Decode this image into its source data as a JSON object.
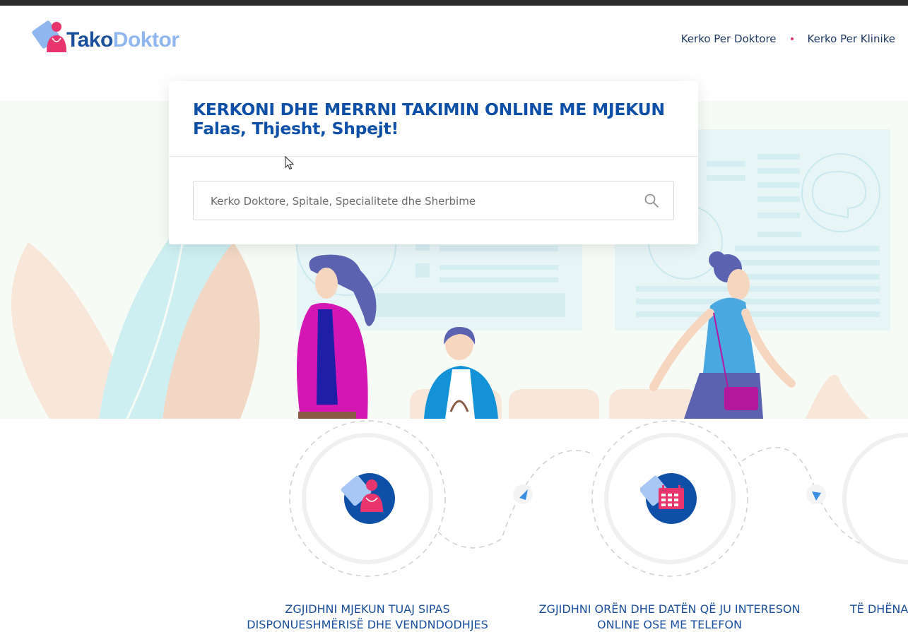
{
  "header": {
    "logo": {
      "part1": "Tako",
      "part2": "Doktor"
    },
    "nav": [
      {
        "label": "Kerko Per Doktore"
      },
      {
        "label": "Kerko Per Klinike"
      }
    ]
  },
  "search_card": {
    "title_line1": "KERKONI DHE MERRNI TAKIMIN ONLINE ME MJEKUN",
    "title_line2": "Falas, Thjesht, Shpejt!",
    "search_placeholder": "Kerko Doktore, Spitale, Specialitete dhe Sherbime"
  },
  "steps": [
    {
      "icon": "doctor-icon",
      "line1": "ZGJIDHNI MJEKUN TUAJ SIPAS",
      "line2": "DISPONUESHMËRISË DHE VENDNDODHJES"
    },
    {
      "icon": "calendar-icon",
      "line1": "ZGJIDHNI ORËN DHE DATËN QË JU INTERESON",
      "line2": "ONLINE OSE ME TELEFON"
    },
    {
      "icon": "step-three-icon",
      "line1": "TË DHËNA",
      "line2": ""
    }
  ],
  "colors": {
    "brand_blue": "#1a4f9c",
    "brand_light": "#8fb6ef",
    "accent_pink": "#e8356d"
  }
}
